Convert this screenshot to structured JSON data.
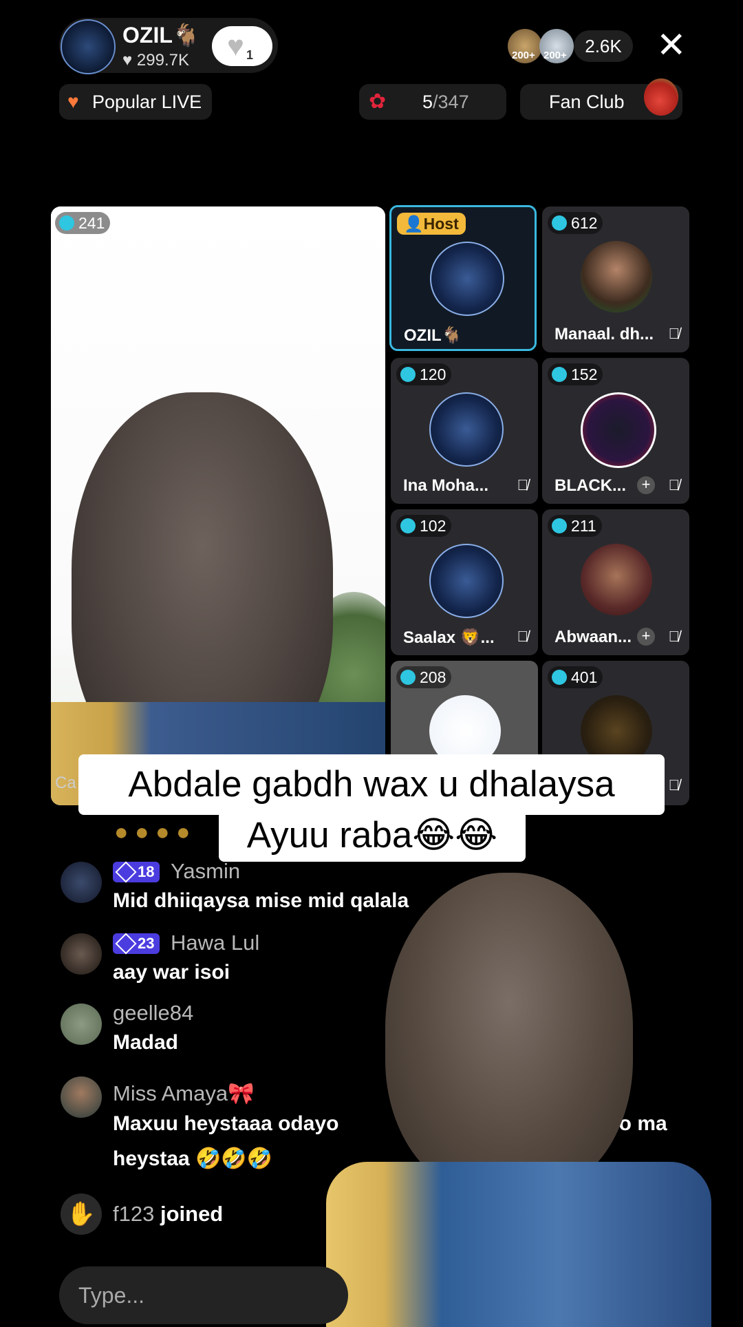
{
  "header": {
    "host_name": "OZIL🐐",
    "host_likes": "299.7K",
    "like_badge": "1",
    "top_gifter_1": "200+",
    "top_gifter_2": "200+",
    "viewer_count": "2.6K",
    "close_icon": "close-icon"
  },
  "badges": {
    "popular_live": "Popular LIVE",
    "rank": "5",
    "rank_total": "/347",
    "fan_club": "Fan Club"
  },
  "main_stage": {
    "count": "241",
    "name_prefix": "Ca"
  },
  "guests": [
    {
      "count": "",
      "tag": "Host",
      "name": "OZIL🐐",
      "muted": false,
      "plus": false
    },
    {
      "count": "612",
      "name": "Manaal. dh...",
      "muted": true,
      "plus": false
    },
    {
      "count": "120",
      "name": "Ina Moha...",
      "muted": true,
      "plus": false
    },
    {
      "count": "152",
      "name": "BLACK...",
      "muted": true,
      "plus": true
    },
    {
      "count": "102",
      "name": "Saalax 🦁...",
      "muted": true,
      "plus": false
    },
    {
      "count": "211",
      "name": "Abwaan...",
      "muted": true,
      "plus": true
    },
    {
      "count": "208",
      "name": "",
      "muted": false,
      "plus": false
    },
    {
      "count": "401",
      "name": "",
      "muted": true,
      "plus": false
    }
  ],
  "caption": {
    "line1": "Abdale gabdh wax u dhalaysa",
    "line2": "Ayuu raba😂😂"
  },
  "chat": [
    {
      "user": "Yasmin",
      "level": "18",
      "text": "Mid dhiiqaysa mise mid qalala"
    },
    {
      "user": "Hawa Lul",
      "level": "23",
      "text": "aay war isoi"
    },
    {
      "user": "geelle84",
      "level": "",
      "text": "Madad"
    },
    {
      "user": "Miss Amaya🎀",
      "level": "",
      "text": "Maxuu heystaaa odayo",
      "text_cont": "vo lo ma",
      "text2": "heystaa 🤣🤣🤣"
    }
  ],
  "join_event": {
    "user": "f123",
    "action": "joined"
  },
  "input": {
    "placeholder": "Type..."
  },
  "colors": {
    "accent_host": "#3ab8e0",
    "level_badge": "#4b3ce0",
    "host_tag": "#f2b93b"
  }
}
